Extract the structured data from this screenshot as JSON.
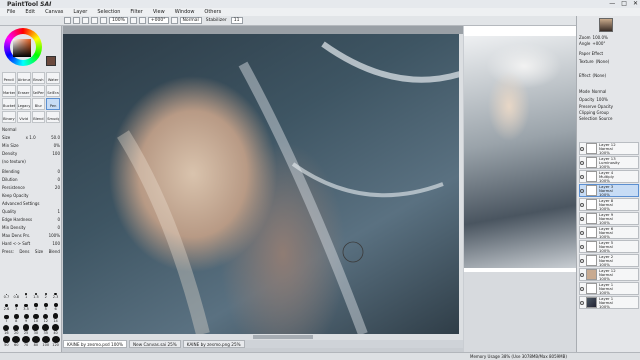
{
  "title": {
    "app_name_small": "PaintTool",
    "app_name_big": "SAI",
    "controls": [
      "—",
      "□",
      "✕"
    ]
  },
  "menu": [
    "File",
    "Edit",
    "Canvas",
    "Layer",
    "Selection",
    "Filter",
    "View",
    "Window",
    "Others"
  ],
  "toolbar": {
    "zoom": "100%",
    "rotation": "+000°",
    "blend": "Normal",
    "stabilizer_label": "Stabilizer",
    "stabilizer_value": "11"
  },
  "colors": {
    "foreground": "#6b4a3e",
    "background": "#ffffff",
    "accent": "#5b8fd1"
  },
  "tools": [
    "Pencil",
    "Airbrush",
    "Brush",
    "Water",
    "Marker",
    "Eraser",
    "SelPen",
    "SelEras",
    "Bucket",
    "Legacy Pen",
    "Blur",
    "Pen",
    "Binary",
    "Vivid",
    "Blend",
    "Smudge"
  ],
  "tool_props": {
    "blend_mode": "Normal",
    "size_label": "Size",
    "size_mult": "x 1.0",
    "size_value": "50.0",
    "min_size_label": "Min Size",
    "min_size_value": "0%",
    "density_label": "Density",
    "density_value": "100",
    "texture_label": "(no texture)",
    "blending_label": "Blending",
    "blending_value": "0",
    "dilution_label": "Dilution",
    "dilution_value": "0",
    "persistence_label": "Persistence",
    "persistence_value": "20",
    "keep_opacity_label": "Keep Opacity",
    "advanced_label": "Advanced Settings",
    "quality_label": "Quality",
    "quality_value": "1",
    "edge_label": "Edge Hardness",
    "edge_value": "0",
    "min_density_label": "Min Density",
    "min_density_value": "0",
    "max_dens_label": "Max Dens Prs.",
    "max_dens_value": "100%",
    "hard_soft_label": "Hard <-> Soft",
    "hard_soft_value": "100",
    "press_label": "Press:",
    "press_opts": [
      "Dens",
      "Size",
      "Blend"
    ]
  },
  "brush_sizes": [
    "0.7",
    "0.8",
    "1",
    "1.5",
    "2",
    "2.3",
    "2.6",
    "3",
    "3.5",
    "4",
    "5",
    "6",
    "7",
    "8",
    "9",
    "10",
    "12",
    "14",
    "16",
    "20",
    "25",
    "30",
    "35",
    "40",
    "50",
    "60",
    "70",
    "80",
    "100",
    "120"
  ],
  "tabs": [
    "KAINE by zesmo.psd",
    "New Canvas.sai",
    "KAINE by zesmo.png"
  ],
  "tab_zooms": [
    "100%",
    "25%",
    "25%"
  ],
  "status": "Memory Usage 38% (Use 3078MB/Max 8059MB)",
  "right_panel": {
    "zoom_label": "Zoom",
    "zoom_value": "100.0%",
    "angle_label": "Angle",
    "angle_value": "+000°",
    "paper_effect": "Paper Effect",
    "texture_label": "Texture",
    "texture_value": "(None)",
    "effect_label": "Effect",
    "effect_value": "(None)",
    "mode_label": "Mode",
    "mode_value": "Normal",
    "opacity_label": "Opacity",
    "opacity_value": "100%",
    "preserve_opacity": "Preserve Opacity",
    "clipping_group": "Clipping Group",
    "selection_source": "Selection Source"
  },
  "layers": [
    {
      "name": "Layer 12",
      "mode": "Normal",
      "opacity": "100%"
    },
    {
      "name": "Layer 13",
      "mode": "Luminosity",
      "opacity": "100%"
    },
    {
      "name": "Layer 4",
      "mode": "Multiply",
      "opacity": "100%"
    },
    {
      "name": "Layer 3",
      "mode": "Normal",
      "opacity": "100%"
    },
    {
      "name": "Layer 8",
      "mode": "Normal",
      "opacity": "100%"
    },
    {
      "name": "Layer 9",
      "mode": "Normal",
      "opacity": "100%"
    },
    {
      "name": "Layer 6",
      "mode": "Normal",
      "opacity": "100%"
    },
    {
      "name": "Layer 5",
      "mode": "Normal",
      "opacity": "100%"
    },
    {
      "name": "Layer 2",
      "mode": "Normal",
      "opacity": "100%"
    },
    {
      "name": "Layer 12",
      "mode": "Normal",
      "opacity": "100%"
    },
    {
      "name": "Layer 1",
      "mode": "Normal",
      "opacity": "100%"
    },
    {
      "name": "Layer 1",
      "mode": "Normal",
      "opacity": "100%"
    }
  ]
}
